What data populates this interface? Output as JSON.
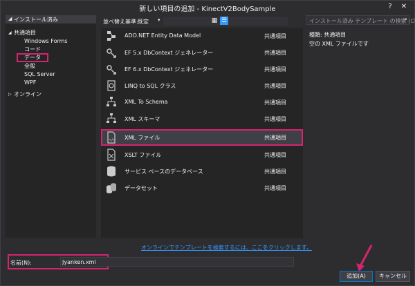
{
  "window": {
    "title": "新しい項目の追加 - KinectV2BodySample",
    "help": "?",
    "close": "✕"
  },
  "left_panel": {
    "header": "インストール済み",
    "tree": [
      {
        "label": "共通項目",
        "level": 0,
        "expanded": true
      },
      {
        "label": "Windows Forms",
        "level": 1
      },
      {
        "label": "コード",
        "level": 1
      },
      {
        "label": "データ",
        "level": 1,
        "highlighted": true
      },
      {
        "label": "全般",
        "level": 1
      },
      {
        "label": "SQL Server",
        "level": 1
      },
      {
        "label": "WPF",
        "level": 1
      },
      {
        "label": "オンライン",
        "level": 0,
        "expanded": false
      }
    ]
  },
  "toolbar": {
    "sort_label": "並べ替え基準:",
    "sort_value": "既定",
    "grid_icon": "grid-view-icon",
    "list_icon": "list-view-icon"
  },
  "search": {
    "placeholder": "インストール済み テンプレート の検索 (Ctrl+E)"
  },
  "items": [
    {
      "label": "ADO.NET Entity Data Model",
      "category": "共通項目",
      "icon": "entity-model-icon"
    },
    {
      "label": "EF 5.x DbContext ジェネレーター",
      "category": "共通項目",
      "icon": "ef-generator-icon"
    },
    {
      "label": "EF 6.x DbContext ジェネレーター",
      "category": "共通項目",
      "icon": "ef-generator-icon"
    },
    {
      "label": "LINQ to SQL クラス",
      "category": "共通項目",
      "icon": "linq-icon"
    },
    {
      "label": "XML To Schema",
      "category": "共通項目",
      "icon": "xml-schema-icon"
    },
    {
      "label": "XML スキーマ",
      "category": "共通項目",
      "icon": "xml-schema-icon"
    },
    {
      "label": "XML ファイル",
      "category": "共通項目",
      "icon": "xml-file-icon",
      "selected": true
    },
    {
      "label": "XSLT ファイル",
      "category": "共通項目",
      "icon": "xslt-file-icon"
    },
    {
      "label": "サービス ベースのデータベース",
      "category": "共通項目",
      "icon": "database-icon"
    },
    {
      "label": "データセット",
      "category": "共通項目",
      "icon": "dataset-icon"
    }
  ],
  "online_link": "オンラインでテンプレートを検索するには、ここをクリックします。",
  "info": {
    "type_line": "種類:  共通項目",
    "description": "空の XML ファイルです"
  },
  "bottom": {
    "name_label": "名前(N):",
    "name_value": "Jyanken.xml",
    "add_button": "追加(A)",
    "cancel_button": "キャンセル"
  },
  "colors": {
    "highlight": "#d6246e",
    "accent": "#007acc",
    "link": "#3399ff"
  }
}
